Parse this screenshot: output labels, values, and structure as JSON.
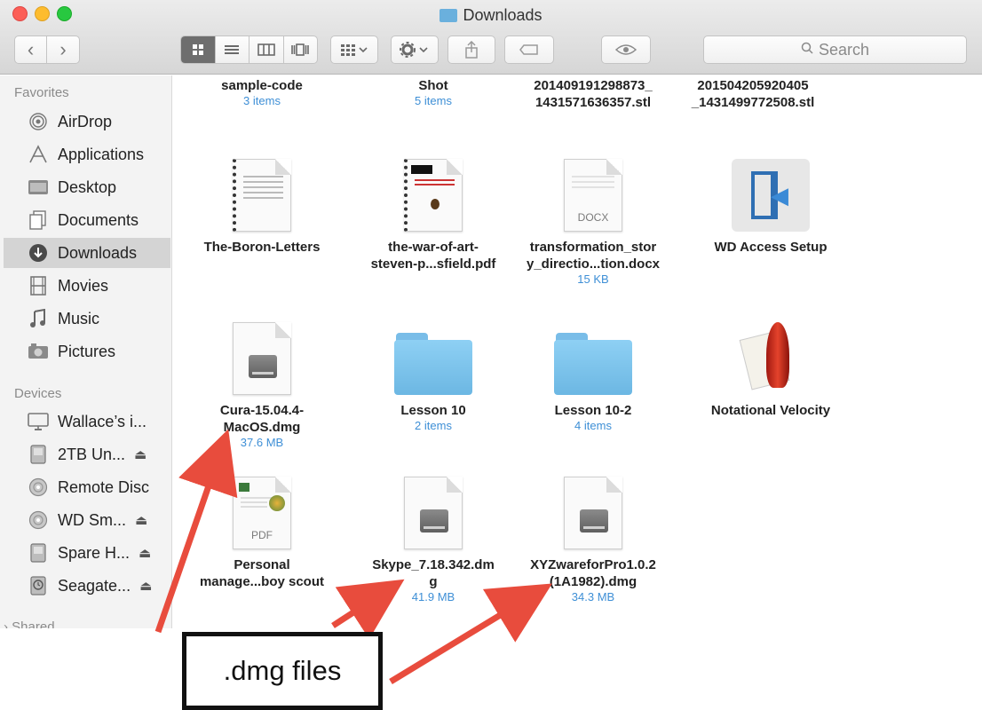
{
  "window": {
    "title": "Downloads",
    "search_placeholder": "Search"
  },
  "toolbar": {
    "back_glyph": "‹",
    "forward_glyph": "›",
    "views": [
      "icon-view",
      "list-view",
      "column-view",
      "cover-flow-view"
    ],
    "arrange_icon": "grid-arrange-icon",
    "action_icon": "gear-icon",
    "share_icon": "share-icon",
    "tag_icon": "tag-icon",
    "quicklook_icon": "eye-icon"
  },
  "sidebar": {
    "favorites_header": "Favorites",
    "favorites": [
      {
        "label": "AirDrop",
        "icon": "airdrop-icon"
      },
      {
        "label": "Applications",
        "icon": "applications-icon"
      },
      {
        "label": "Desktop",
        "icon": "desktop-icon"
      },
      {
        "label": "Documents",
        "icon": "documents-icon"
      },
      {
        "label": "Downloads",
        "icon": "downloads-icon",
        "selected": true
      },
      {
        "label": "Movies",
        "icon": "movies-icon"
      },
      {
        "label": "Music",
        "icon": "music-icon"
      },
      {
        "label": "Pictures",
        "icon": "pictures-icon"
      }
    ],
    "devices_header": "Devices",
    "devices": [
      {
        "label": "Wallace’s i...",
        "icon": "computer-icon"
      },
      {
        "label": "2TB Un...",
        "icon": "drive-icon",
        "eject": true
      },
      {
        "label": "Remote Disc",
        "icon": "disc-icon"
      },
      {
        "label": "WD Sm...",
        "icon": "disc-icon",
        "eject": true
      },
      {
        "label": "Spare H...",
        "icon": "drive-icon",
        "eject": true
      },
      {
        "label": "Seagate...",
        "icon": "backup-drive-icon",
        "eject": true
      }
    ],
    "shared_header": "Shared"
  },
  "files": [
    {
      "name": "sample-code",
      "meta": "3 items",
      "kind": "folder-top"
    },
    {
      "name": "Shot",
      "meta": "5 items",
      "kind": "folder-top"
    },
    {
      "name": "201409191298873_\n1431571636357.stl",
      "meta": "",
      "kind": "file-top"
    },
    {
      "name": "201504205920405\n_1431499772508.stl",
      "meta": "",
      "kind": "file-top"
    },
    {
      "name": "The-Boron-Letters",
      "meta": "",
      "kind": "document"
    },
    {
      "name": "the-war-of-art-\nsteven-p...sfield.pdf",
      "meta": "",
      "kind": "pdf"
    },
    {
      "name": "transformation_stor\ny_directio...tion.docx",
      "meta": "15 KB",
      "kind": "docx",
      "ext": "DOCX"
    },
    {
      "name": "WD Access Setup",
      "meta": "",
      "kind": "app"
    },
    {
      "name": "Cura-15.04.4-\nMacOS.dmg",
      "meta": "37.6 MB",
      "kind": "dmg"
    },
    {
      "name": "Lesson 10",
      "meta": "2 items",
      "kind": "folder"
    },
    {
      "name": "Lesson 10-2",
      "meta": "4 items",
      "kind": "folder"
    },
    {
      "name": "Notational Velocity",
      "meta": "",
      "kind": "rocket-app"
    },
    {
      "name": "Personal\nmanage...boy scout",
      "meta": "",
      "kind": "pdf-doc",
      "ext": "PDF"
    },
    {
      "name": "Skype_7.18.342.dm\ng",
      "meta": "41.9 MB",
      "kind": "dmg"
    },
    {
      "name": "XYZwareforPro1.0.2\n(1A1982).dmg",
      "meta": "34.3 MB",
      "kind": "dmg"
    }
  ],
  "annotation": {
    "label": ".dmg files",
    "color": "#e84c3d"
  }
}
